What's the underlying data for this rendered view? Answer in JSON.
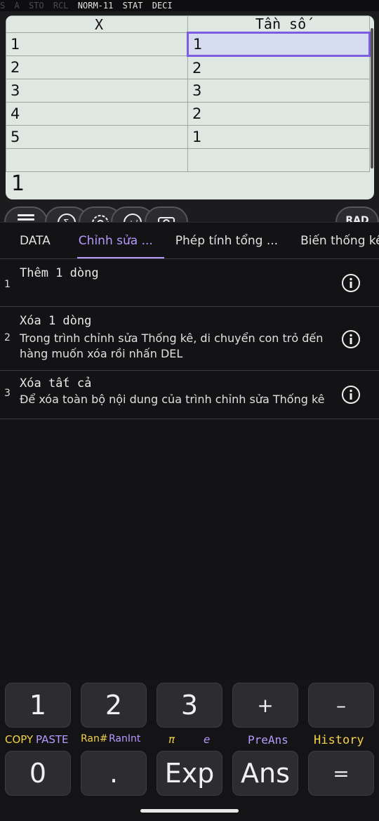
{
  "status_bar": {
    "dim_items": [
      "S",
      "A",
      "STO",
      "RCL"
    ],
    "lit_items": [
      "NORM-11",
      "STAT",
      "DECI"
    ]
  },
  "stat_table": {
    "headers": [
      "X",
      "Tần số"
    ],
    "rows": [
      [
        "1",
        "1"
      ],
      [
        "2",
        "2"
      ],
      [
        "3",
        "3"
      ],
      [
        "4",
        "2"
      ],
      [
        "5",
        "1"
      ],
      [
        "",
        ""
      ]
    ],
    "input_value": "1"
  },
  "toolbar": {
    "icons": [
      "menu-icon",
      "sigma-icon",
      "gear-icon",
      "plus-minus-icon",
      "camera-icon"
    ],
    "angle_mode": "RAD"
  },
  "tabs": [
    {
      "label": "DATA"
    },
    {
      "label": "Chỉnh sửa ..."
    },
    {
      "label": "Phép tính tổng ..."
    },
    {
      "label": "Biến thống kê .."
    }
  ],
  "edit_items": [
    {
      "number": "1",
      "title": "Thêm 1 dòng",
      "description": ""
    },
    {
      "number": "2",
      "title": "Xóa 1 dòng",
      "description": "Trong trình chỉnh sửa Thống kê, di chuyển con trỏ đến hàng muốn xóa rồi nhấn DEL"
    },
    {
      "number": "3",
      "title": "Xóa tất cả",
      "description": "Để xóa toàn bộ nội dung của trình chỉnh sửa Thống kê"
    }
  ],
  "keypad": {
    "row1": [
      "1",
      "2",
      "3",
      "+",
      "–"
    ],
    "shift_labels": {
      "copy": "COPY",
      "paste": "PASTE",
      "ran": "Ran#",
      "ranint": "RanInt",
      "pi": "π",
      "e": "e",
      "preans": "PreAns",
      "history": "History"
    },
    "row2": [
      "0",
      ".",
      "Exp",
      "Ans",
      "="
    ]
  },
  "colors": {
    "accent": "#b69bff",
    "yellow": "#f5d24a",
    "screen_bg": "#dfe7e3"
  }
}
